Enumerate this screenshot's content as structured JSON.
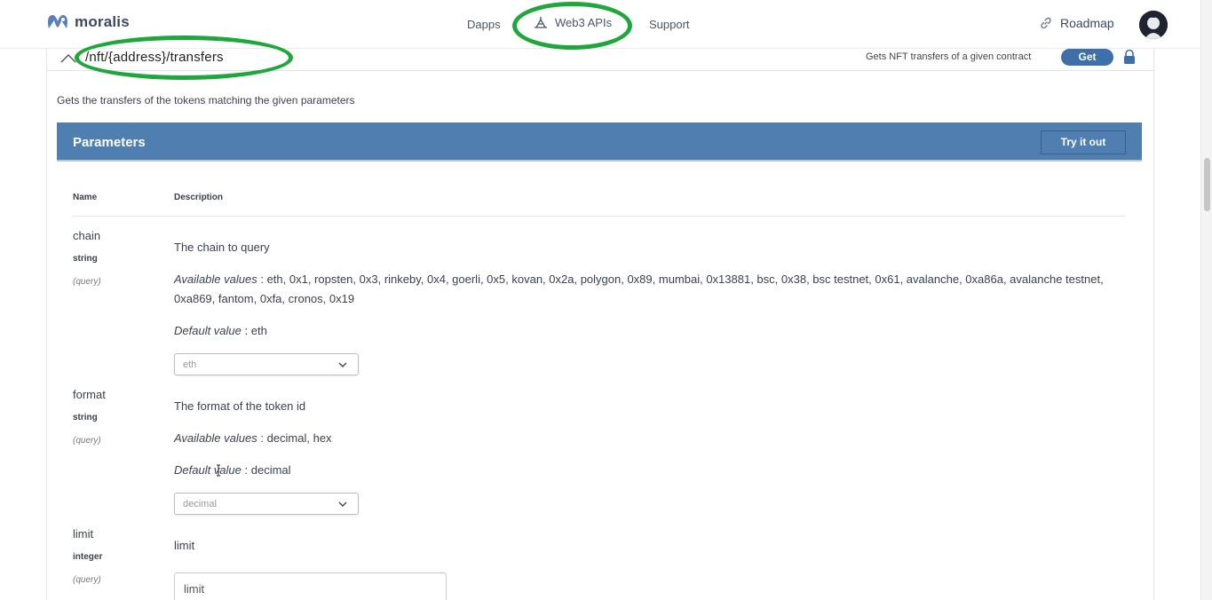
{
  "nav": {
    "logo_text": "moralis",
    "links": [
      "Dapps",
      "Web3 APIs",
      "Support"
    ],
    "roadmap": "Roadmap"
  },
  "endpoint": {
    "path": "/nft/{address}/transfers",
    "summary": "Gets NFT transfers of a given contract",
    "method": "Get",
    "description": "Gets the transfers of the tokens matching the given parameters"
  },
  "parameters": {
    "title": "Parameters",
    "try_button": "Try it out",
    "headers": {
      "name": "Name",
      "description": "Description"
    },
    "available_label": "Available values",
    "default_label": "Default value",
    "items": [
      {
        "name": "chain",
        "type": "string",
        "in": "(query)",
        "description": "The chain to query",
        "available_values": ": eth, 0x1, ropsten, 0x3, rinkeby, 0x4, goerli, 0x5, kovan, 0x2a, polygon, 0x89, mumbai, 0x13881, bsc, 0x38, bsc testnet, 0x61, avalanche, 0xa86a, avalanche testnet, 0xa869, fantom, 0xfa, cronos, 0x19",
        "default_value": ": eth",
        "selected": "eth"
      },
      {
        "name": "format",
        "type": "string",
        "in": "(query)",
        "description": "The format of the token id",
        "available_values": ": decimal, hex",
        "default_value": ": decimal",
        "selected": "decimal"
      },
      {
        "name": "limit",
        "type": "integer",
        "in": "(query)",
        "description": "limit",
        "placeholder": "limit"
      }
    ]
  },
  "colors": {
    "accent_blue": "#4f7fb0",
    "get_button": "#3d6fa8",
    "highlight_ring": "#1ea73b"
  },
  "icons": [
    "moralis-logo-icon",
    "web3-apis-icon",
    "link-icon",
    "avatar",
    "chevron-up-icon",
    "lock-icon",
    "chevron-down-icon"
  ]
}
